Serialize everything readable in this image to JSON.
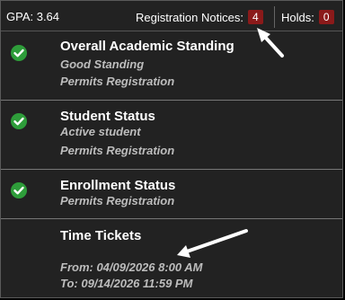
{
  "header": {
    "gpa_label": "GPA: 3.64",
    "notices_label": "Registration Notices:",
    "notices_count": "4",
    "holds_label": "Holds:",
    "holds_count": "0",
    "badge_color": "#8b1a1a"
  },
  "sections": [
    {
      "title": "Overall Academic Standing",
      "lines": [
        "Good Standing",
        "Permits Registration"
      ],
      "icon": "check-circle-icon",
      "status_color": "#2e9d3a"
    },
    {
      "title": "Student Status",
      "lines": [
        "Active student",
        "Permits Registration"
      ],
      "icon": "check-circle-icon",
      "status_color": "#2e9d3a"
    },
    {
      "title": "Enrollment Status",
      "lines": [
        "Permits Registration"
      ],
      "icon": "check-circle-icon",
      "status_color": "#2e9d3a"
    },
    {
      "title": "Time Tickets",
      "lines": [
        "From: 04/09/2026 8:00 AM",
        "To: 09/14/2026 11:59 PM"
      ]
    }
  ],
  "annotations": {
    "arrow_color": "#ffffff"
  }
}
